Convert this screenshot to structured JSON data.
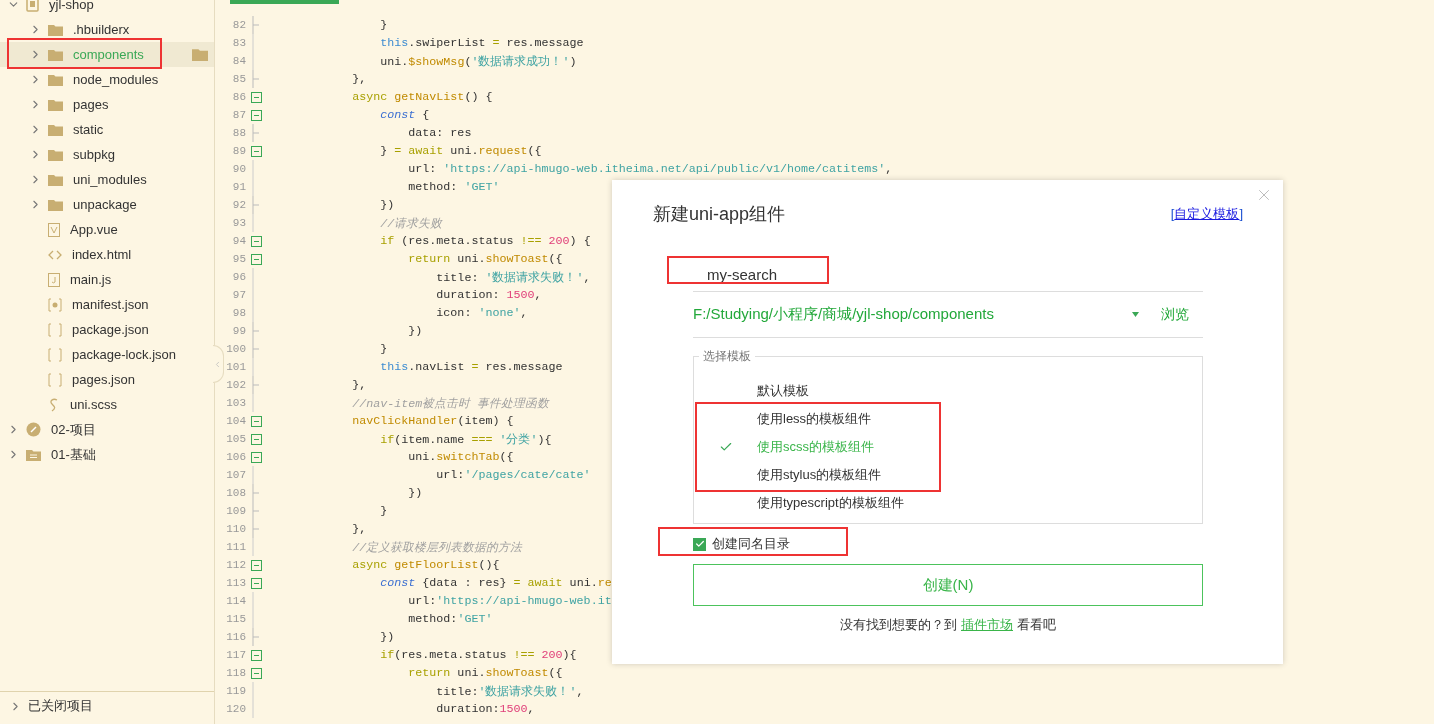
{
  "sidebar": {
    "tree": [
      {
        "label": "yjl-shop",
        "kind": "project-root",
        "expanded": true,
        "selected": false,
        "annotated": false,
        "children": [
          {
            "label": ".hbuilderx",
            "kind": "folder",
            "expanded": false,
            "selected": false,
            "annotated": false
          },
          {
            "label": "components",
            "kind": "folder",
            "expanded": false,
            "selected": true,
            "annotated": true
          },
          {
            "label": "node_modules",
            "kind": "folder",
            "expanded": false,
            "selected": false,
            "annotated": false
          },
          {
            "label": "pages",
            "kind": "folder",
            "expanded": false,
            "selected": false,
            "annotated": false
          },
          {
            "label": "static",
            "kind": "folder",
            "expanded": false,
            "selected": false,
            "annotated": false
          },
          {
            "label": "subpkg",
            "kind": "folder",
            "expanded": false,
            "selected": false,
            "annotated": false
          },
          {
            "label": "uni_modules",
            "kind": "folder",
            "expanded": false,
            "selected": false,
            "annotated": false
          },
          {
            "label": "unpackage",
            "kind": "folder",
            "expanded": false,
            "selected": false,
            "annotated": false
          },
          {
            "label": "App.vue",
            "kind": "vue",
            "selected": false,
            "annotated": false
          },
          {
            "label": "index.html",
            "kind": "html",
            "selected": false,
            "annotated": false
          },
          {
            "label": "main.js",
            "kind": "js",
            "selected": false,
            "annotated": false
          },
          {
            "label": "manifest.json",
            "kind": "manifest",
            "selected": false,
            "annotated": false
          },
          {
            "label": "package.json",
            "kind": "json",
            "selected": false,
            "annotated": false
          },
          {
            "label": "package-lock.json",
            "kind": "json",
            "selected": false,
            "annotated": false
          },
          {
            "label": "pages.json",
            "kind": "json",
            "selected": false,
            "annotated": false
          },
          {
            "label": "uni.scss",
            "kind": "scss",
            "selected": false,
            "annotated": false
          }
        ]
      },
      {
        "label": "02-项目",
        "kind": "project",
        "expanded": false,
        "selected": false,
        "annotated": false
      },
      {
        "label": "01-基础",
        "kind": "drive",
        "expanded": false,
        "selected": false,
        "annotated": false
      }
    ],
    "closed_projects": {
      "label": "已关闭项目",
      "expanded": false
    }
  },
  "editor": {
    "lines": [
      {
        "num": "82",
        "kind": "fold-end",
        "tokens": [
          {
            "kind": "plain",
            "text": "                }"
          }
        ]
      },
      {
        "num": "83",
        "kind": "plain",
        "tokens": [
          {
            "kind": "this",
            "text": "                this"
          },
          {
            "kind": "plain",
            "text": ".swiperList "
          },
          {
            "kind": "op",
            "text": "="
          },
          {
            "kind": "plain",
            "text": " res.message"
          }
        ]
      },
      {
        "num": "84",
        "kind": "plain",
        "tokens": [
          {
            "kind": "plain",
            "text": "                uni."
          },
          {
            "kind": "fn",
            "text": "$showMsg"
          },
          {
            "kind": "plain",
            "text": "("
          },
          {
            "kind": "str",
            "text": "'数据请求成功！'"
          },
          {
            "kind": "plain",
            "text": ")"
          }
        ]
      },
      {
        "num": "85",
        "kind": "fold-end",
        "tokens": [
          {
            "kind": "plain",
            "text": "            },"
          }
        ]
      },
      {
        "num": "86",
        "kind": "fold-start",
        "tokens": [
          {
            "kind": "kw",
            "text": "            async"
          },
          {
            "kind": "fn",
            "text": " getNavList"
          },
          {
            "kind": "plain",
            "text": "() {"
          }
        ]
      },
      {
        "num": "87",
        "kind": "fold-start",
        "tokens": [
          {
            "kind": "decl",
            "text": "                const"
          },
          {
            "kind": "plain",
            "text": " {"
          }
        ]
      },
      {
        "num": "88",
        "kind": "fold-end",
        "tokens": [
          {
            "kind": "plain",
            "text": "                    data: res"
          }
        ]
      },
      {
        "num": "89",
        "kind": "fold-start",
        "tokens": [
          {
            "kind": "plain",
            "text": "                } "
          },
          {
            "kind": "op",
            "text": "="
          },
          {
            "kind": "kw",
            "text": " await"
          },
          {
            "kind": "plain",
            "text": " uni."
          },
          {
            "kind": "fn",
            "text": "request"
          },
          {
            "kind": "plain",
            "text": "({"
          }
        ]
      },
      {
        "num": "90",
        "kind": "plain",
        "tokens": [
          {
            "kind": "plain",
            "text": "                    url: "
          },
          {
            "kind": "str",
            "text": "'https://api-hmugo-web.itheima.net/api/public/v1/home/catitems'"
          },
          {
            "kind": "plain",
            "text": ","
          }
        ]
      },
      {
        "num": "91",
        "kind": "plain",
        "tokens": [
          {
            "kind": "plain",
            "text": "                    method: "
          },
          {
            "kind": "str",
            "text": "'GET'"
          }
        ]
      },
      {
        "num": "92",
        "kind": "fold-end",
        "tokens": [
          {
            "kind": "plain",
            "text": "                })"
          }
        ]
      },
      {
        "num": "93",
        "kind": "plain",
        "tokens": [
          {
            "kind": "cm",
            "text": "                //请求失败"
          }
        ]
      },
      {
        "num": "94",
        "kind": "fold-start",
        "tokens": [
          {
            "kind": "kw",
            "text": "                if"
          },
          {
            "kind": "plain",
            "text": " (res.meta.status "
          },
          {
            "kind": "op",
            "text": "!=="
          },
          {
            "kind": "num",
            "text": " 200"
          },
          {
            "kind": "plain",
            "text": ") {"
          }
        ]
      },
      {
        "num": "95",
        "kind": "fold-start",
        "tokens": [
          {
            "kind": "kw",
            "text": "                    return"
          },
          {
            "kind": "plain",
            "text": " uni."
          },
          {
            "kind": "fn",
            "text": "showToast"
          },
          {
            "kind": "plain",
            "text": "({"
          }
        ]
      },
      {
        "num": "96",
        "kind": "plain",
        "tokens": [
          {
            "kind": "plain",
            "text": "                        title: "
          },
          {
            "kind": "str",
            "text": "'数据请求失败！'"
          },
          {
            "kind": "plain",
            "text": ","
          }
        ]
      },
      {
        "num": "97",
        "kind": "plain",
        "tokens": [
          {
            "kind": "plain",
            "text": "                        duration: "
          },
          {
            "kind": "num",
            "text": "1500"
          },
          {
            "kind": "plain",
            "text": ","
          }
        ]
      },
      {
        "num": "98",
        "kind": "plain",
        "tokens": [
          {
            "kind": "plain",
            "text": "                        icon: "
          },
          {
            "kind": "str",
            "text": "'none'"
          },
          {
            "kind": "plain",
            "text": ","
          }
        ]
      },
      {
        "num": "99",
        "kind": "fold-end",
        "tokens": [
          {
            "kind": "plain",
            "text": "                    })"
          }
        ]
      },
      {
        "num": "100",
        "kind": "fold-end",
        "tokens": [
          {
            "kind": "plain",
            "text": "                }"
          }
        ]
      },
      {
        "num": "101",
        "kind": "plain",
        "tokens": [
          {
            "kind": "this",
            "text": "                this"
          },
          {
            "kind": "plain",
            "text": ".navList "
          },
          {
            "kind": "op",
            "text": "="
          },
          {
            "kind": "plain",
            "text": " res.message"
          }
        ]
      },
      {
        "num": "102",
        "kind": "fold-end",
        "tokens": [
          {
            "kind": "plain",
            "text": "            },"
          }
        ]
      },
      {
        "num": "103",
        "kind": "plain",
        "tokens": [
          {
            "kind": "cm",
            "text": "            //nav-item被点击时 事件处理函数"
          }
        ]
      },
      {
        "num": "104",
        "kind": "fold-start",
        "tokens": [
          {
            "kind": "fn",
            "text": "            navClickHandler"
          },
          {
            "kind": "plain",
            "text": "(item) {"
          }
        ]
      },
      {
        "num": "105",
        "kind": "fold-start",
        "tokens": [
          {
            "kind": "kw",
            "text": "                if"
          },
          {
            "kind": "plain",
            "text": "(item.name "
          },
          {
            "kind": "op",
            "text": "==="
          },
          {
            "kind": "str",
            "text": " '分类'"
          },
          {
            "kind": "plain",
            "text": "){"
          }
        ]
      },
      {
        "num": "106",
        "kind": "fold-start",
        "tokens": [
          {
            "kind": "plain",
            "text": "                    uni."
          },
          {
            "kind": "fn",
            "text": "switchTab"
          },
          {
            "kind": "plain",
            "text": "({"
          }
        ]
      },
      {
        "num": "107",
        "kind": "plain",
        "tokens": [
          {
            "kind": "plain",
            "text": "                        url:"
          },
          {
            "kind": "str",
            "text": "'/pages/cate/cate'"
          }
        ]
      },
      {
        "num": "108",
        "kind": "fold-end",
        "tokens": [
          {
            "kind": "plain",
            "text": "                    })"
          }
        ]
      },
      {
        "num": "109",
        "kind": "fold-end",
        "tokens": [
          {
            "kind": "plain",
            "text": "                }"
          }
        ]
      },
      {
        "num": "110",
        "kind": "fold-end",
        "tokens": [
          {
            "kind": "plain",
            "text": "            },"
          }
        ]
      },
      {
        "num": "111",
        "kind": "plain",
        "tokens": [
          {
            "kind": "cm",
            "text": "            //定义获取楼层列表数据的方法"
          }
        ]
      },
      {
        "num": "112",
        "kind": "fold-start",
        "tokens": [
          {
            "kind": "kw",
            "text": "            async"
          },
          {
            "kind": "fn",
            "text": " getFloorList"
          },
          {
            "kind": "plain",
            "text": "(){"
          }
        ]
      },
      {
        "num": "113",
        "kind": "fold-start",
        "tokens": [
          {
            "kind": "decl",
            "text": "                const"
          },
          {
            "kind": "plain",
            "text": " {data : res} "
          },
          {
            "kind": "op",
            "text": "="
          },
          {
            "kind": "kw",
            "text": " await"
          },
          {
            "kind": "plain",
            "text": " uni."
          },
          {
            "kind": "fn",
            "text": "re"
          }
        ]
      },
      {
        "num": "114",
        "kind": "plain",
        "tokens": [
          {
            "kind": "plain",
            "text": "                    url:"
          },
          {
            "kind": "str",
            "text": "'https://api-hmugo-web.it"
          }
        ]
      },
      {
        "num": "115",
        "kind": "plain",
        "tokens": [
          {
            "kind": "plain",
            "text": "                    method:"
          },
          {
            "kind": "str",
            "text": "'GET'"
          }
        ]
      },
      {
        "num": "116",
        "kind": "fold-end",
        "tokens": [
          {
            "kind": "plain",
            "text": "                })"
          }
        ]
      },
      {
        "num": "117",
        "kind": "fold-start",
        "tokens": [
          {
            "kind": "kw",
            "text": "                if"
          },
          {
            "kind": "plain",
            "text": "(res.meta.status "
          },
          {
            "kind": "op",
            "text": "!=="
          },
          {
            "kind": "num",
            "text": " 200"
          },
          {
            "kind": "plain",
            "text": "){"
          }
        ]
      },
      {
        "num": "118",
        "kind": "fold-start",
        "tokens": [
          {
            "kind": "kw",
            "text": "                    return"
          },
          {
            "kind": "plain",
            "text": " uni."
          },
          {
            "kind": "fn",
            "text": "showToast"
          },
          {
            "kind": "plain",
            "text": "({"
          }
        ]
      },
      {
        "num": "119",
        "kind": "plain",
        "tokens": [
          {
            "kind": "plain",
            "text": "                        title:"
          },
          {
            "kind": "str",
            "text": "'数据请求失败！'"
          },
          {
            "kind": "plain",
            "text": ","
          }
        ]
      },
      {
        "num": "120",
        "kind": "plain",
        "tokens": [
          {
            "kind": "plain",
            "text": "                        duration:"
          },
          {
            "kind": "num",
            "text": "1500"
          },
          {
            "kind": "plain",
            "text": ","
          }
        ]
      }
    ]
  },
  "dialog": {
    "title": "新建uni-app组件",
    "custom_template": {
      "open": "[",
      "link": "自定义模板",
      "close": "]"
    },
    "name_field": {
      "value": "my-search",
      "annotated": true
    },
    "path_field": {
      "value": "F:/Studying/小程序/商城/yjl-shop/components",
      "browse": "浏览"
    },
    "templates": {
      "legend": "选择模板",
      "options": [
        {
          "label": "默认模板",
          "selected": false,
          "annotated": false
        },
        {
          "label": "使用less的模板组件",
          "selected": false,
          "annotated": true
        },
        {
          "label": "使用scss的模板组件",
          "selected": true,
          "annotated": true
        },
        {
          "label": "使用stylus的模板组件",
          "selected": false,
          "annotated": true
        },
        {
          "label": "使用typescript的模板组件",
          "selected": false,
          "annotated": false
        }
      ]
    },
    "same_name_dir": {
      "label": "创建同名目录",
      "checked": true,
      "annotated": true
    },
    "create_button": "创建(N)",
    "footer": {
      "before": "没有找到想要的？到",
      "link": "插件市场",
      "after": "看看吧"
    }
  }
}
